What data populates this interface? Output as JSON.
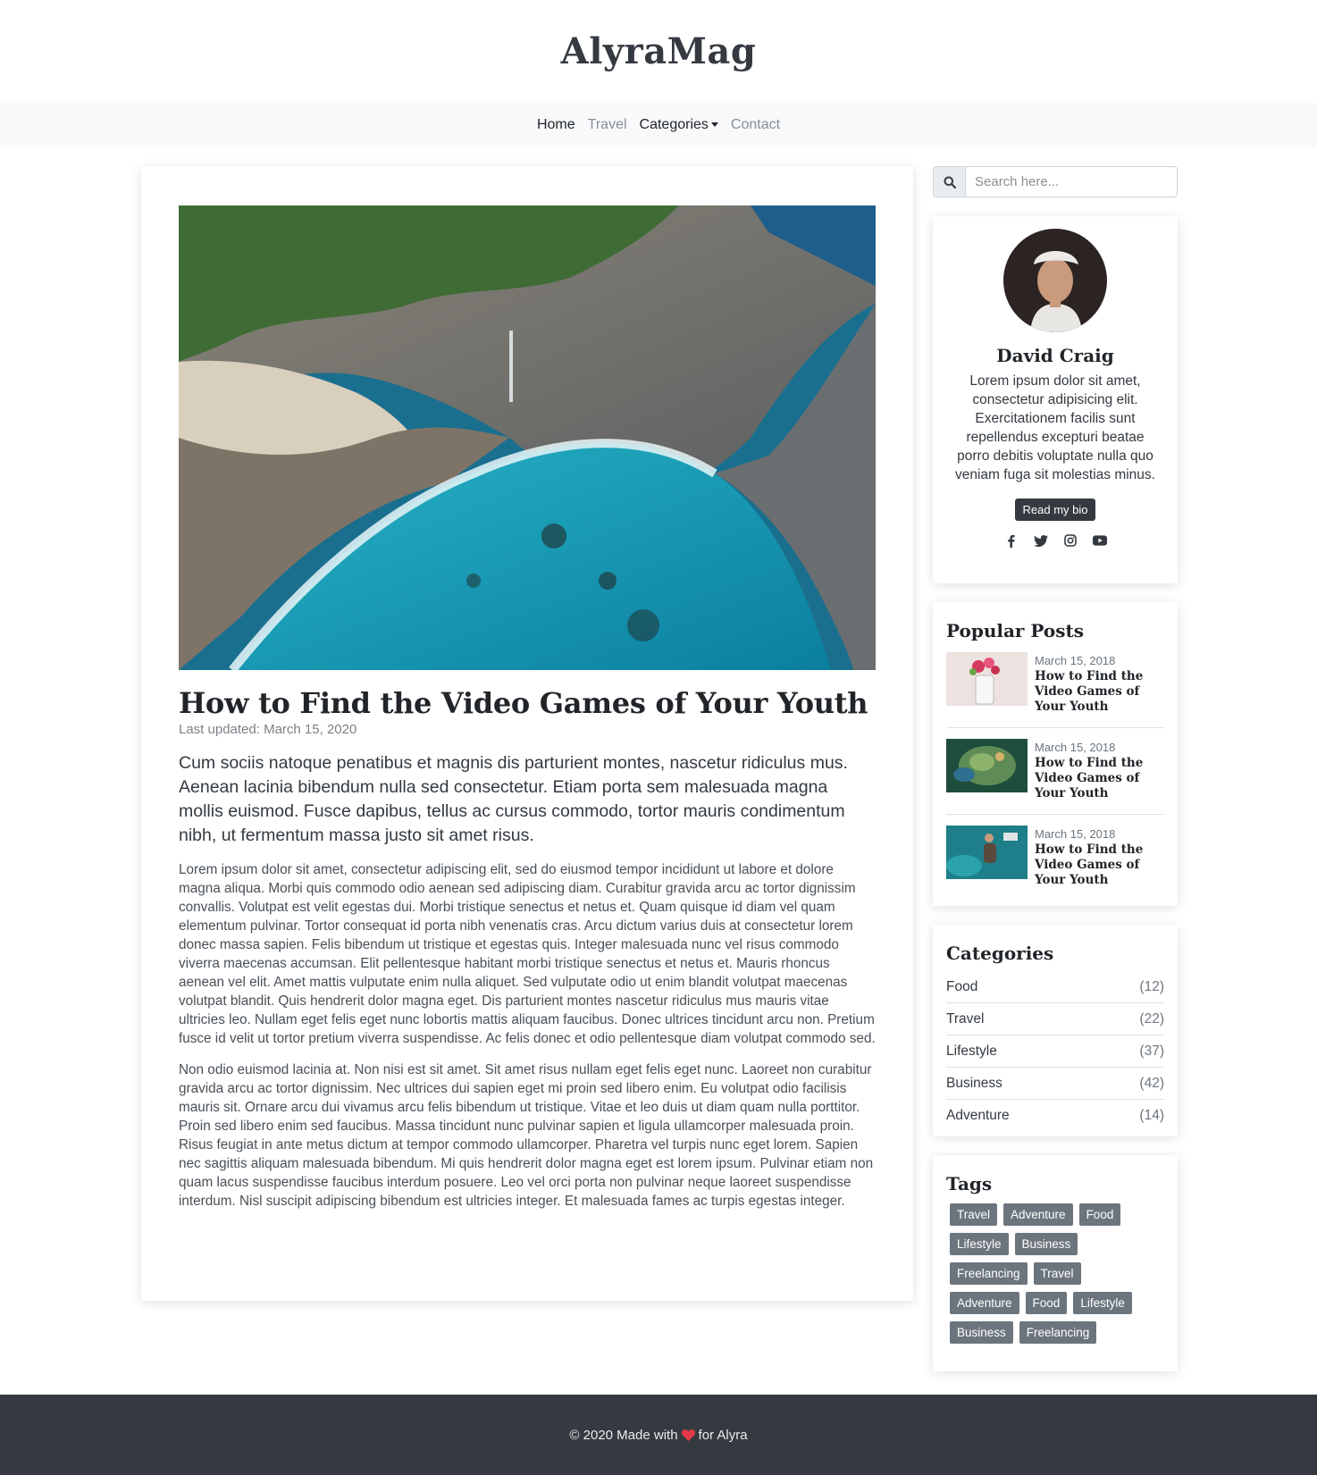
{
  "brand": "AlyraMag",
  "nav": {
    "items": [
      {
        "label": "Home"
      },
      {
        "label": "Travel"
      },
      {
        "label": "Categories"
      },
      {
        "label": "Contact"
      }
    ]
  },
  "post": {
    "title": "How to Find the Video Games of Your Youth",
    "meta": "Last updated: March 15, 2020",
    "lead": "Cum sociis natoque penatibus et magnis dis parturient montes, nascetur ridiculus mus. Aenean lacinia bibendum nulla sed consectetur. Etiam porta sem malesuada magna mollis euismod. Fusce dapibus, tellus ac cursus commodo, tortor mauris condimentum nibh, ut fermentum massa justo sit amet risus.",
    "paragraphs": [
      "Lorem ipsum dolor sit amet, consectetur adipiscing elit, sed do eiusmod tempor incididunt ut labore et dolore magna aliqua. Morbi quis commodo odio aenean sed adipiscing diam. Curabitur gravida arcu ac tortor dignissim convallis. Volutpat est velit egestas dui. Morbi tristique senectus et netus et. Quam quisque id diam vel quam elementum pulvinar. Tortor consequat id porta nibh venenatis cras. Arcu dictum varius duis at consectetur lorem donec massa sapien. Felis bibendum ut tristique et egestas quis. Integer malesuada nunc vel risus commodo viverra maecenas accumsan. Elit pellentesque habitant morbi tristique senectus et netus et. Mauris rhoncus aenean vel elit. Amet mattis vulputate enim nulla aliquet. Sed vulputate odio ut enim blandit volutpat maecenas volutpat blandit. Quis hendrerit dolor magna eget. Dis parturient montes nascetur ridiculus mus mauris vitae ultricies leo. Nullam eget felis eget nunc lobortis mattis aliquam faucibus. Donec ultrices tincidunt arcu non. Pretium fusce id velit ut tortor pretium viverra suspendisse. Ac felis donec et odio pellentesque diam volutpat commodo sed.",
      "Non odio euismod lacinia at. Non nisi est sit amet. Sit amet risus nullam eget felis eget nunc. Laoreet non curabitur gravida arcu ac tortor dignissim. Nec ultrices dui sapien eget mi proin sed libero enim. Eu volutpat odio facilisis mauris sit. Ornare arcu dui vivamus arcu felis bibendum ut tristique. Vitae et leo duis ut diam quam nulla porttitor. Proin sed libero enim sed faucibus. Massa tincidunt nunc pulvinar sapien et ligula ullamcorper malesuada proin. Risus feugiat in ante metus dictum at tempor commodo ullamcorper. Pharetra vel turpis nunc eget lorem. Sapien nec sagittis aliquam malesuada bibendum. Mi quis hendrerit dolor magna eget est lorem ipsum. Pulvinar etiam non quam lacus suspendisse faucibus interdum posuere. Leo vel orci porta non pulvinar neque laoreet suspendisse interdum. Nisl suscipit adipiscing bibendum est ultricies integer. Et malesuada fames ac turpis egestas integer."
    ]
  },
  "search": {
    "placeholder": "Search here..."
  },
  "profile": {
    "name": "David Craig",
    "bio": "Lorem ipsum dolor sit amet, consectetur adipisicing elit. Exercitationem facilis sunt repellendus excepturi beatae porro debitis voluptate nulla quo veniam fuga sit molestias minus.",
    "button": "Read my bio",
    "socials": [
      "facebook-icon",
      "twitter-icon",
      "instagram-icon",
      "youtube-icon"
    ]
  },
  "popular": {
    "title": "Popular Posts",
    "posts": [
      {
        "date": "March 15, 2018",
        "title": "How to Find the Video Games of Your Youth"
      },
      {
        "date": "March 15, 2018",
        "title": "How to Find the Video Games of Your Youth"
      },
      {
        "date": "March 15, 2018",
        "title": "How to Find the Video Games of Your Youth"
      }
    ]
  },
  "categories": {
    "title": "Categories",
    "items": [
      {
        "name": "Food",
        "count": "(12)"
      },
      {
        "name": "Travel",
        "count": "(22)"
      },
      {
        "name": "Lifestyle",
        "count": "(37)"
      },
      {
        "name": "Business",
        "count": "(42)"
      },
      {
        "name": "Adventure",
        "count": "(14)"
      }
    ]
  },
  "tags": {
    "title": "Tags",
    "items": [
      "Travel",
      "Adventure",
      "Food",
      "Lifestyle",
      "Business",
      "Freelancing",
      "Travel",
      "Adventure",
      "Food",
      "Lifestyle",
      "Business",
      "Freelancing"
    ]
  },
  "footer": {
    "before": "© 2020 Made with",
    "after": "for Alyra",
    "heart_color": "#e63946"
  },
  "colors": {
    "dark": "#343a40",
    "tag_bg": "#6c757d",
    "nav_bg": "#f8f9fa"
  }
}
